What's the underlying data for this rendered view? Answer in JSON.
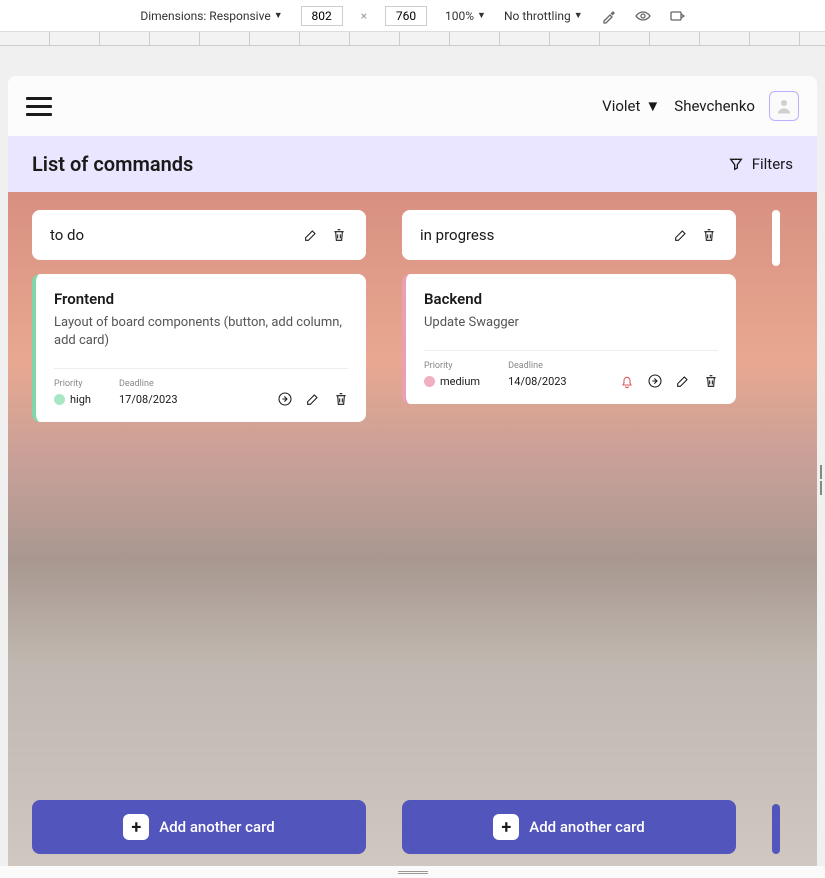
{
  "devtools": {
    "dimensions_label": "Dimensions: Responsive",
    "width": "802",
    "height": "760",
    "zoom": "100%",
    "throttling": "No throttling"
  },
  "header": {
    "theme": "Violet",
    "username": "Shevchenko"
  },
  "subheader": {
    "title": "List of commands",
    "filters_label": "Filters"
  },
  "columns": [
    {
      "title": "to do",
      "add_label": "Add another card",
      "cards": [
        {
          "title": "Frontend",
          "description": "Layout of board components (button, add column, add card)",
          "priority_label": "Priority",
          "priority": "high",
          "deadline_label": "Deadline",
          "deadline": "17/08/2023",
          "has_bell": false
        }
      ]
    },
    {
      "title": "in progress",
      "add_label": "Add another card",
      "cards": [
        {
          "title": "Backend",
          "description": "Update Swagger",
          "priority_label": "Priority",
          "priority": "medium",
          "deadline_label": "Deadline",
          "deadline": "14/08/2023",
          "has_bell": true
        }
      ]
    }
  ]
}
